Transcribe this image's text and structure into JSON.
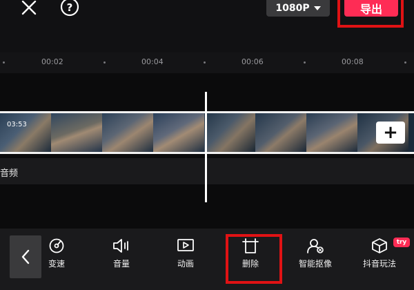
{
  "topbar": {
    "close_icon": "close-icon",
    "help_icon": "help-icon",
    "resolution": "1080P",
    "export_label": "导出"
  },
  "ruler": {
    "ticks": [
      "00:02",
      "00:04",
      "00:06",
      "00:08"
    ]
  },
  "timeline": {
    "clip_duration": "03:53",
    "audio_label": "音频",
    "add_icon": "+"
  },
  "toolbar": {
    "tools": [
      {
        "label": "变速",
        "icon": "speed-icon"
      },
      {
        "label": "音量",
        "icon": "volume-icon"
      },
      {
        "label": "动画",
        "icon": "animation-icon"
      },
      {
        "label": "删除",
        "icon": "delete-icon"
      },
      {
        "label": "智能抠像",
        "icon": "cutout-icon"
      },
      {
        "label": "抖音玩法",
        "icon": "effects-cube-icon"
      }
    ],
    "try_badge": "try"
  },
  "colors": {
    "accent": "#fe2c55",
    "highlight_border": "#e01214",
    "background": "#111113"
  }
}
